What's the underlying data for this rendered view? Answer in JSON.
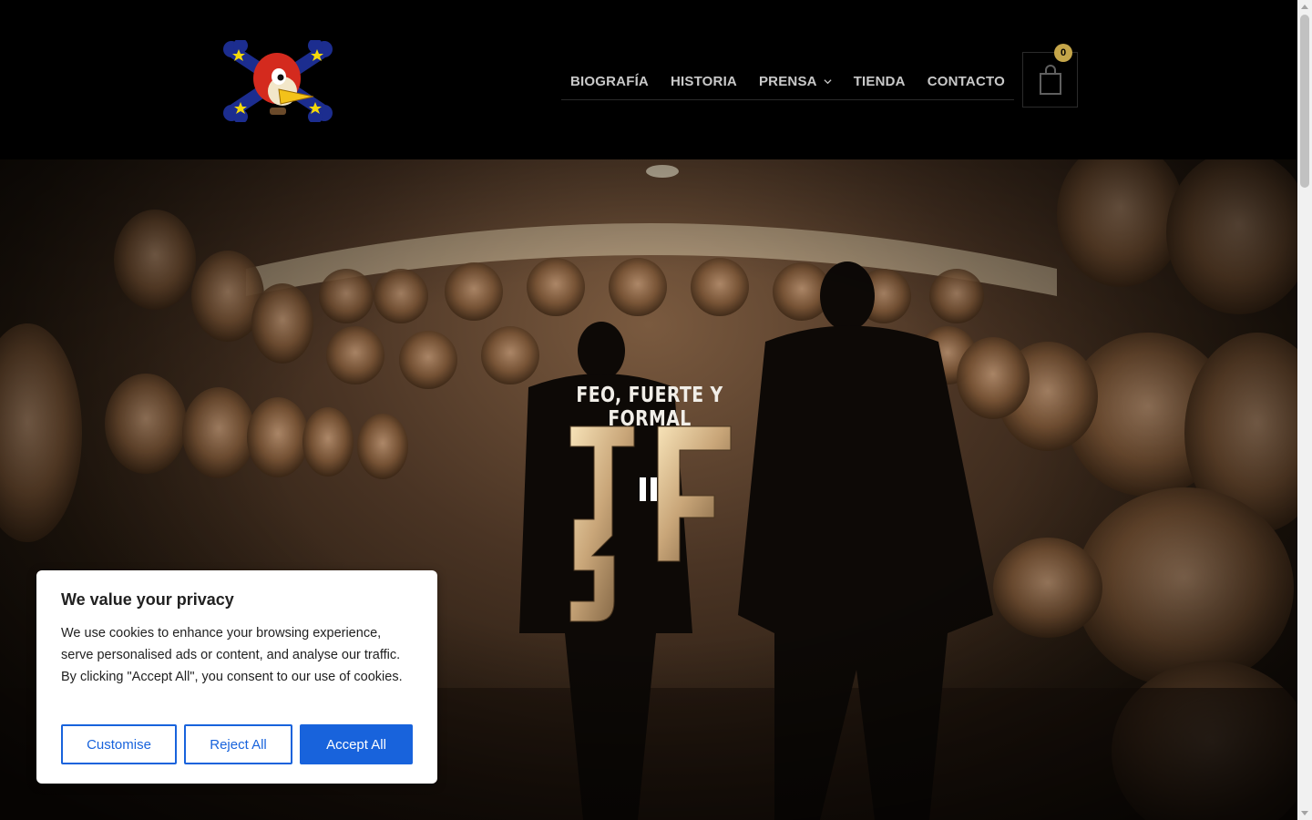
{
  "nav": {
    "items": [
      {
        "label": "BIOGRAFÍA",
        "has_dropdown": false
      },
      {
        "label": "HISTORIA",
        "has_dropdown": false
      },
      {
        "label": "PRENSA",
        "has_dropdown": true
      },
      {
        "label": "TIENDA",
        "has_dropdown": false
      },
      {
        "label": "CONTACTO",
        "has_dropdown": false
      }
    ]
  },
  "cart": {
    "count": "0",
    "icon": "shopping-bag-icon"
  },
  "hero": {
    "tagline": "FEO, FUERTE Y FORMAL",
    "logo_text": "3F",
    "video_control": "pause-icon"
  },
  "cookie": {
    "title": "We value your privacy",
    "text": "We use cookies to enhance your browsing experience, serve personalised ads or content, and analyse our traffic. By clicking \"Accept All\", you consent to our use of cookies.",
    "customise": "Customise",
    "reject": "Reject All",
    "accept": "Accept All"
  },
  "colors": {
    "accent_blue": "#1863dc",
    "gold": "#c5a64a",
    "nav_text": "#c9c9c9",
    "header_bg": "#000000"
  }
}
